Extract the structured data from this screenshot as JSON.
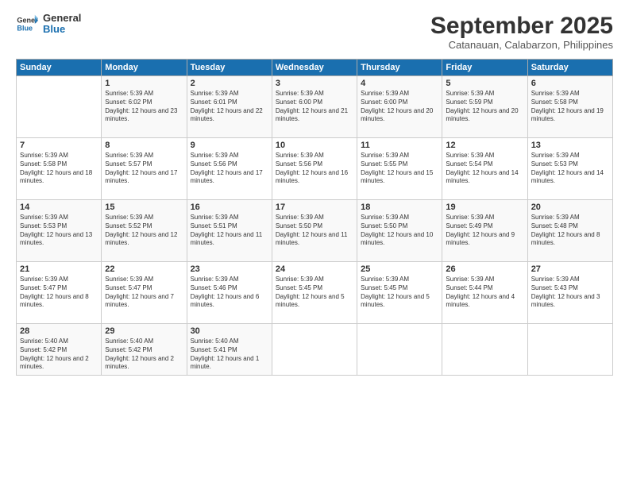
{
  "logo": {
    "line1": "General",
    "line2": "Blue"
  },
  "title": "September 2025",
  "subtitle": "Catanauan, Calabarzon, Philippines",
  "headers": [
    "Sunday",
    "Monday",
    "Tuesday",
    "Wednesday",
    "Thursday",
    "Friday",
    "Saturday"
  ],
  "weeks": [
    [
      {
        "day": "",
        "sunrise": "",
        "sunset": "",
        "daylight": ""
      },
      {
        "day": "1",
        "sunrise": "Sunrise: 5:39 AM",
        "sunset": "Sunset: 6:02 PM",
        "daylight": "Daylight: 12 hours and 23 minutes."
      },
      {
        "day": "2",
        "sunrise": "Sunrise: 5:39 AM",
        "sunset": "Sunset: 6:01 PM",
        "daylight": "Daylight: 12 hours and 22 minutes."
      },
      {
        "day": "3",
        "sunrise": "Sunrise: 5:39 AM",
        "sunset": "Sunset: 6:00 PM",
        "daylight": "Daylight: 12 hours and 21 minutes."
      },
      {
        "day": "4",
        "sunrise": "Sunrise: 5:39 AM",
        "sunset": "Sunset: 6:00 PM",
        "daylight": "Daylight: 12 hours and 20 minutes."
      },
      {
        "day": "5",
        "sunrise": "Sunrise: 5:39 AM",
        "sunset": "Sunset: 5:59 PM",
        "daylight": "Daylight: 12 hours and 20 minutes."
      },
      {
        "day": "6",
        "sunrise": "Sunrise: 5:39 AM",
        "sunset": "Sunset: 5:58 PM",
        "daylight": "Daylight: 12 hours and 19 minutes."
      }
    ],
    [
      {
        "day": "7",
        "sunrise": "Sunrise: 5:39 AM",
        "sunset": "Sunset: 5:58 PM",
        "daylight": "Daylight: 12 hours and 18 minutes."
      },
      {
        "day": "8",
        "sunrise": "Sunrise: 5:39 AM",
        "sunset": "Sunset: 5:57 PM",
        "daylight": "Daylight: 12 hours and 17 minutes."
      },
      {
        "day": "9",
        "sunrise": "Sunrise: 5:39 AM",
        "sunset": "Sunset: 5:56 PM",
        "daylight": "Daylight: 12 hours and 17 minutes."
      },
      {
        "day": "10",
        "sunrise": "Sunrise: 5:39 AM",
        "sunset": "Sunset: 5:56 PM",
        "daylight": "Daylight: 12 hours and 16 minutes."
      },
      {
        "day": "11",
        "sunrise": "Sunrise: 5:39 AM",
        "sunset": "Sunset: 5:55 PM",
        "daylight": "Daylight: 12 hours and 15 minutes."
      },
      {
        "day": "12",
        "sunrise": "Sunrise: 5:39 AM",
        "sunset": "Sunset: 5:54 PM",
        "daylight": "Daylight: 12 hours and 14 minutes."
      },
      {
        "day": "13",
        "sunrise": "Sunrise: 5:39 AM",
        "sunset": "Sunset: 5:53 PM",
        "daylight": "Daylight: 12 hours and 14 minutes."
      }
    ],
    [
      {
        "day": "14",
        "sunrise": "Sunrise: 5:39 AM",
        "sunset": "Sunset: 5:53 PM",
        "daylight": "Daylight: 12 hours and 13 minutes."
      },
      {
        "day": "15",
        "sunrise": "Sunrise: 5:39 AM",
        "sunset": "Sunset: 5:52 PM",
        "daylight": "Daylight: 12 hours and 12 minutes."
      },
      {
        "day": "16",
        "sunrise": "Sunrise: 5:39 AM",
        "sunset": "Sunset: 5:51 PM",
        "daylight": "Daylight: 12 hours and 11 minutes."
      },
      {
        "day": "17",
        "sunrise": "Sunrise: 5:39 AM",
        "sunset": "Sunset: 5:50 PM",
        "daylight": "Daylight: 12 hours and 11 minutes."
      },
      {
        "day": "18",
        "sunrise": "Sunrise: 5:39 AM",
        "sunset": "Sunset: 5:50 PM",
        "daylight": "Daylight: 12 hours and 10 minutes."
      },
      {
        "day": "19",
        "sunrise": "Sunrise: 5:39 AM",
        "sunset": "Sunset: 5:49 PM",
        "daylight": "Daylight: 12 hours and 9 minutes."
      },
      {
        "day": "20",
        "sunrise": "Sunrise: 5:39 AM",
        "sunset": "Sunset: 5:48 PM",
        "daylight": "Daylight: 12 hours and 8 minutes."
      }
    ],
    [
      {
        "day": "21",
        "sunrise": "Sunrise: 5:39 AM",
        "sunset": "Sunset: 5:47 PM",
        "daylight": "Daylight: 12 hours and 8 minutes."
      },
      {
        "day": "22",
        "sunrise": "Sunrise: 5:39 AM",
        "sunset": "Sunset: 5:47 PM",
        "daylight": "Daylight: 12 hours and 7 minutes."
      },
      {
        "day": "23",
        "sunrise": "Sunrise: 5:39 AM",
        "sunset": "Sunset: 5:46 PM",
        "daylight": "Daylight: 12 hours and 6 minutes."
      },
      {
        "day": "24",
        "sunrise": "Sunrise: 5:39 AM",
        "sunset": "Sunset: 5:45 PM",
        "daylight": "Daylight: 12 hours and 5 minutes."
      },
      {
        "day": "25",
        "sunrise": "Sunrise: 5:39 AM",
        "sunset": "Sunset: 5:45 PM",
        "daylight": "Daylight: 12 hours and 5 minutes."
      },
      {
        "day": "26",
        "sunrise": "Sunrise: 5:39 AM",
        "sunset": "Sunset: 5:44 PM",
        "daylight": "Daylight: 12 hours and 4 minutes."
      },
      {
        "day": "27",
        "sunrise": "Sunrise: 5:39 AM",
        "sunset": "Sunset: 5:43 PM",
        "daylight": "Daylight: 12 hours and 3 minutes."
      }
    ],
    [
      {
        "day": "28",
        "sunrise": "Sunrise: 5:40 AM",
        "sunset": "Sunset: 5:42 PM",
        "daylight": "Daylight: 12 hours and 2 minutes."
      },
      {
        "day": "29",
        "sunrise": "Sunrise: 5:40 AM",
        "sunset": "Sunset: 5:42 PM",
        "daylight": "Daylight: 12 hours and 2 minutes."
      },
      {
        "day": "30",
        "sunrise": "Sunrise: 5:40 AM",
        "sunset": "Sunset: 5:41 PM",
        "daylight": "Daylight: 12 hours and 1 minute."
      },
      {
        "day": "",
        "sunrise": "",
        "sunset": "",
        "daylight": ""
      },
      {
        "day": "",
        "sunrise": "",
        "sunset": "",
        "daylight": ""
      },
      {
        "day": "",
        "sunrise": "",
        "sunset": "",
        "daylight": ""
      },
      {
        "day": "",
        "sunrise": "",
        "sunset": "",
        "daylight": ""
      }
    ]
  ]
}
